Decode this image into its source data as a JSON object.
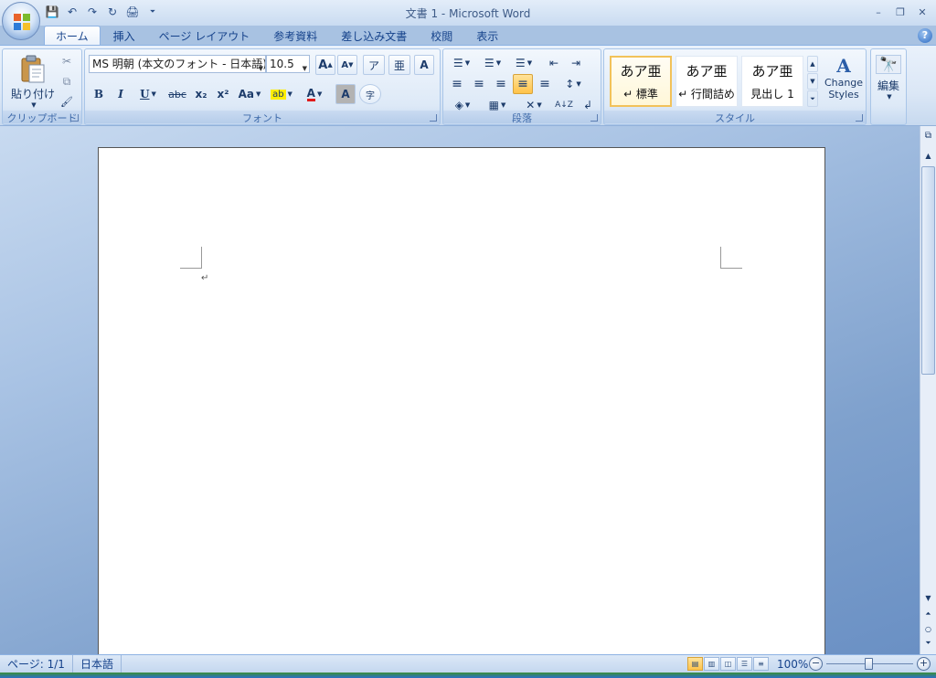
{
  "window": {
    "title": "文書 1 - Microsoft Word",
    "controls": {
      "minimize": "–",
      "restore": "❐",
      "close": "✕"
    }
  },
  "qat": {
    "save_icon": "💾",
    "undo_icon": "↶",
    "redo_icon": "↷",
    "repeat_icon": "↻",
    "print_icon": "🖨",
    "customize_icon": "⏷"
  },
  "tabs": [
    {
      "label": "ホーム",
      "active": true
    },
    {
      "label": "挿入"
    },
    {
      "label": "ページ レイアウト"
    },
    {
      "label": "参考資料"
    },
    {
      "label": "差し込み文書"
    },
    {
      "label": "校閲"
    },
    {
      "label": "表示"
    }
  ],
  "help": "?",
  "ribbon": {
    "clipboard": {
      "group_label": "クリップボード",
      "paste_label": "貼り付け",
      "cut_icon": "✂",
      "copy_icon": "⧉",
      "format_painter_icon": "🖌"
    },
    "font": {
      "group_label": "フォント",
      "font_name": "MS 明朝 (本文のフォント - 日本語)",
      "font_size": "10.5",
      "grow": "A",
      "shrink": "A",
      "phonetic": "ア",
      "char_border_icon": "亜",
      "enclose_icon": "A",
      "bold": "B",
      "italic": "I",
      "underline": "U",
      "strike": "abc",
      "subscript": "x₂",
      "superscript": "x²",
      "change_case": "Aa",
      "highlight": "ab",
      "font_color": "A",
      "char_shading": "A",
      "enclosed_char": "字"
    },
    "paragraph": {
      "group_label": "段落",
      "bullets": "☰",
      "numbering": "☰",
      "multilevel": "☰",
      "decrease_indent": "⇤",
      "increase_indent": "⇥",
      "align_left": "≡",
      "center": "≡",
      "align_right": "≡",
      "justify": "≡",
      "distributed": "≡",
      "line_spacing": "↕",
      "shading": "◈",
      "borders": "▦",
      "asian_layout": "✕",
      "sort": "A↓Z",
      "show_marks": "↲"
    },
    "styles": {
      "group_label": "スタイル",
      "items": [
        {
          "sample": "あア亜",
          "name": "↵ 標準"
        },
        {
          "sample": "あア亜",
          "name": "↵ 行間詰め"
        },
        {
          "sample": "あア亜",
          "name": "見出し 1"
        }
      ],
      "change_styles_line1": "Change",
      "change_styles_line2": "Styles"
    },
    "editing": {
      "label": "編集",
      "icon": "🔭"
    }
  },
  "document": {
    "paragraph_mark": "↵"
  },
  "statusbar": {
    "page": "ページ: 1/1",
    "language": "日本語",
    "zoom": "100%",
    "zoom_minus": "−",
    "zoom_plus": "+"
  },
  "colors": {
    "accent": "#15428b",
    "ribbon": "#dbe7f6",
    "active_button": "#ffc34a"
  }
}
